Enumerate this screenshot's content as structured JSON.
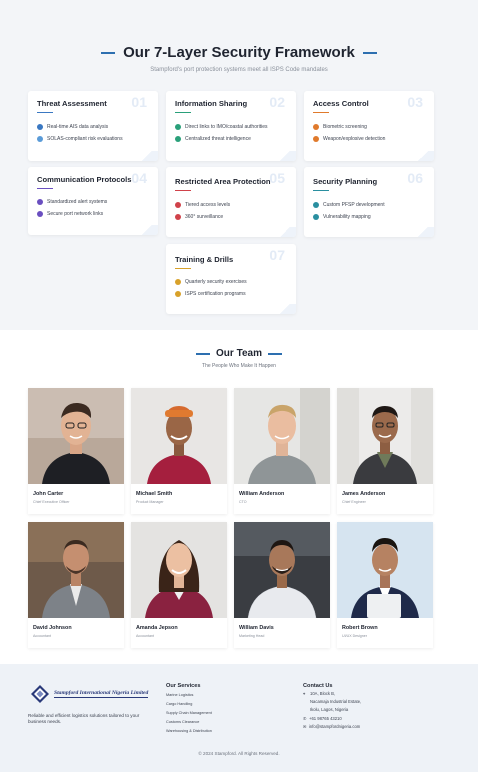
{
  "framework": {
    "title": "Our 7-Layer Security Framework",
    "subtitle": "Stampford's port protection systems meet all ISPS Code mandates",
    "cards": [
      {
        "num": "01",
        "title": "Threat Assessment",
        "items": [
          "Real-time AIS data analysis",
          "SOLAS-compliant risk evaluations"
        ]
      },
      {
        "num": "02",
        "title": "Information Sharing",
        "items": [
          "Direct links to IMO/coastal authorities",
          "Centralized threat intelligence"
        ]
      },
      {
        "num": "03",
        "title": "Access Control",
        "items": [
          "Biometric screening",
          "Weapon/explosive detection"
        ]
      },
      {
        "num": "04",
        "title": "Communication Protocols",
        "items": [
          "Standardized alert systems",
          "Secure port network links"
        ]
      },
      {
        "num": "05",
        "title": "Restricted Area Protection",
        "items": [
          "Tiered access levels",
          "360° surveillance"
        ]
      },
      {
        "num": "06",
        "title": "Security Planning",
        "items": [
          "Custom PFSP development",
          "Vulnerability mapping"
        ]
      },
      {
        "num": "07",
        "title": "Training & Drills",
        "items": [
          "Quarterly security exercises",
          "ISPS certification programs"
        ]
      }
    ],
    "icon_names": [
      "chart-icon",
      "shield-check-icon",
      "upload-icon",
      "database-icon",
      "fingerprint-icon",
      "search-icon",
      "megaphone-icon",
      "network-icon",
      "shield-icon",
      "camera-icon",
      "document-icon",
      "map-icon",
      "calendar-icon",
      "certificate-icon"
    ]
  },
  "team": {
    "title": "Our Team",
    "subtitle": "The People Who Make It Happen",
    "members": [
      {
        "name": "John Carter",
        "role": "Chief Executive Officer"
      },
      {
        "name": "Michael Smith",
        "role": "Product Manager"
      },
      {
        "name": "William Anderson",
        "role": "CTO"
      },
      {
        "name": "James Anderson",
        "role": "Chief Engineer"
      },
      {
        "name": "David Johnson",
        "role": "Accountant"
      },
      {
        "name": "Amanda Jepson",
        "role": "Accountant"
      },
      {
        "name": "William Davis",
        "role": "Marketing Head"
      },
      {
        "name": "Robert Brown",
        "role": "UI/UX Designer"
      }
    ]
  },
  "footer": {
    "company": "Stampford International Nigeria Limited",
    "about": "Reliable and efficient logistics solutions tailored to your business needs.",
    "services_title": "Our Services",
    "services": [
      "Marine Logistics",
      "Cargo Handling",
      "Supply Chain Management",
      "Customs Clearance",
      "Warehousing & Distribution"
    ],
    "contact_title": "Contact Us",
    "address_line1": "10A, Block B,",
    "address_line2": "Nacamaja Industrial Estate,",
    "address_line3": "Ikolu, Lagos, Nigeria",
    "phone": "+61 98765 43210",
    "email": "info@stampfordnigeria.com",
    "copyright": "© 2024 Stampford. All Rights Reserved."
  },
  "colors": {
    "accent": "#2d6fb0",
    "heading": "#1f2430",
    "muted": "#8a909b",
    "footer_bg": "#eef2f7"
  }
}
